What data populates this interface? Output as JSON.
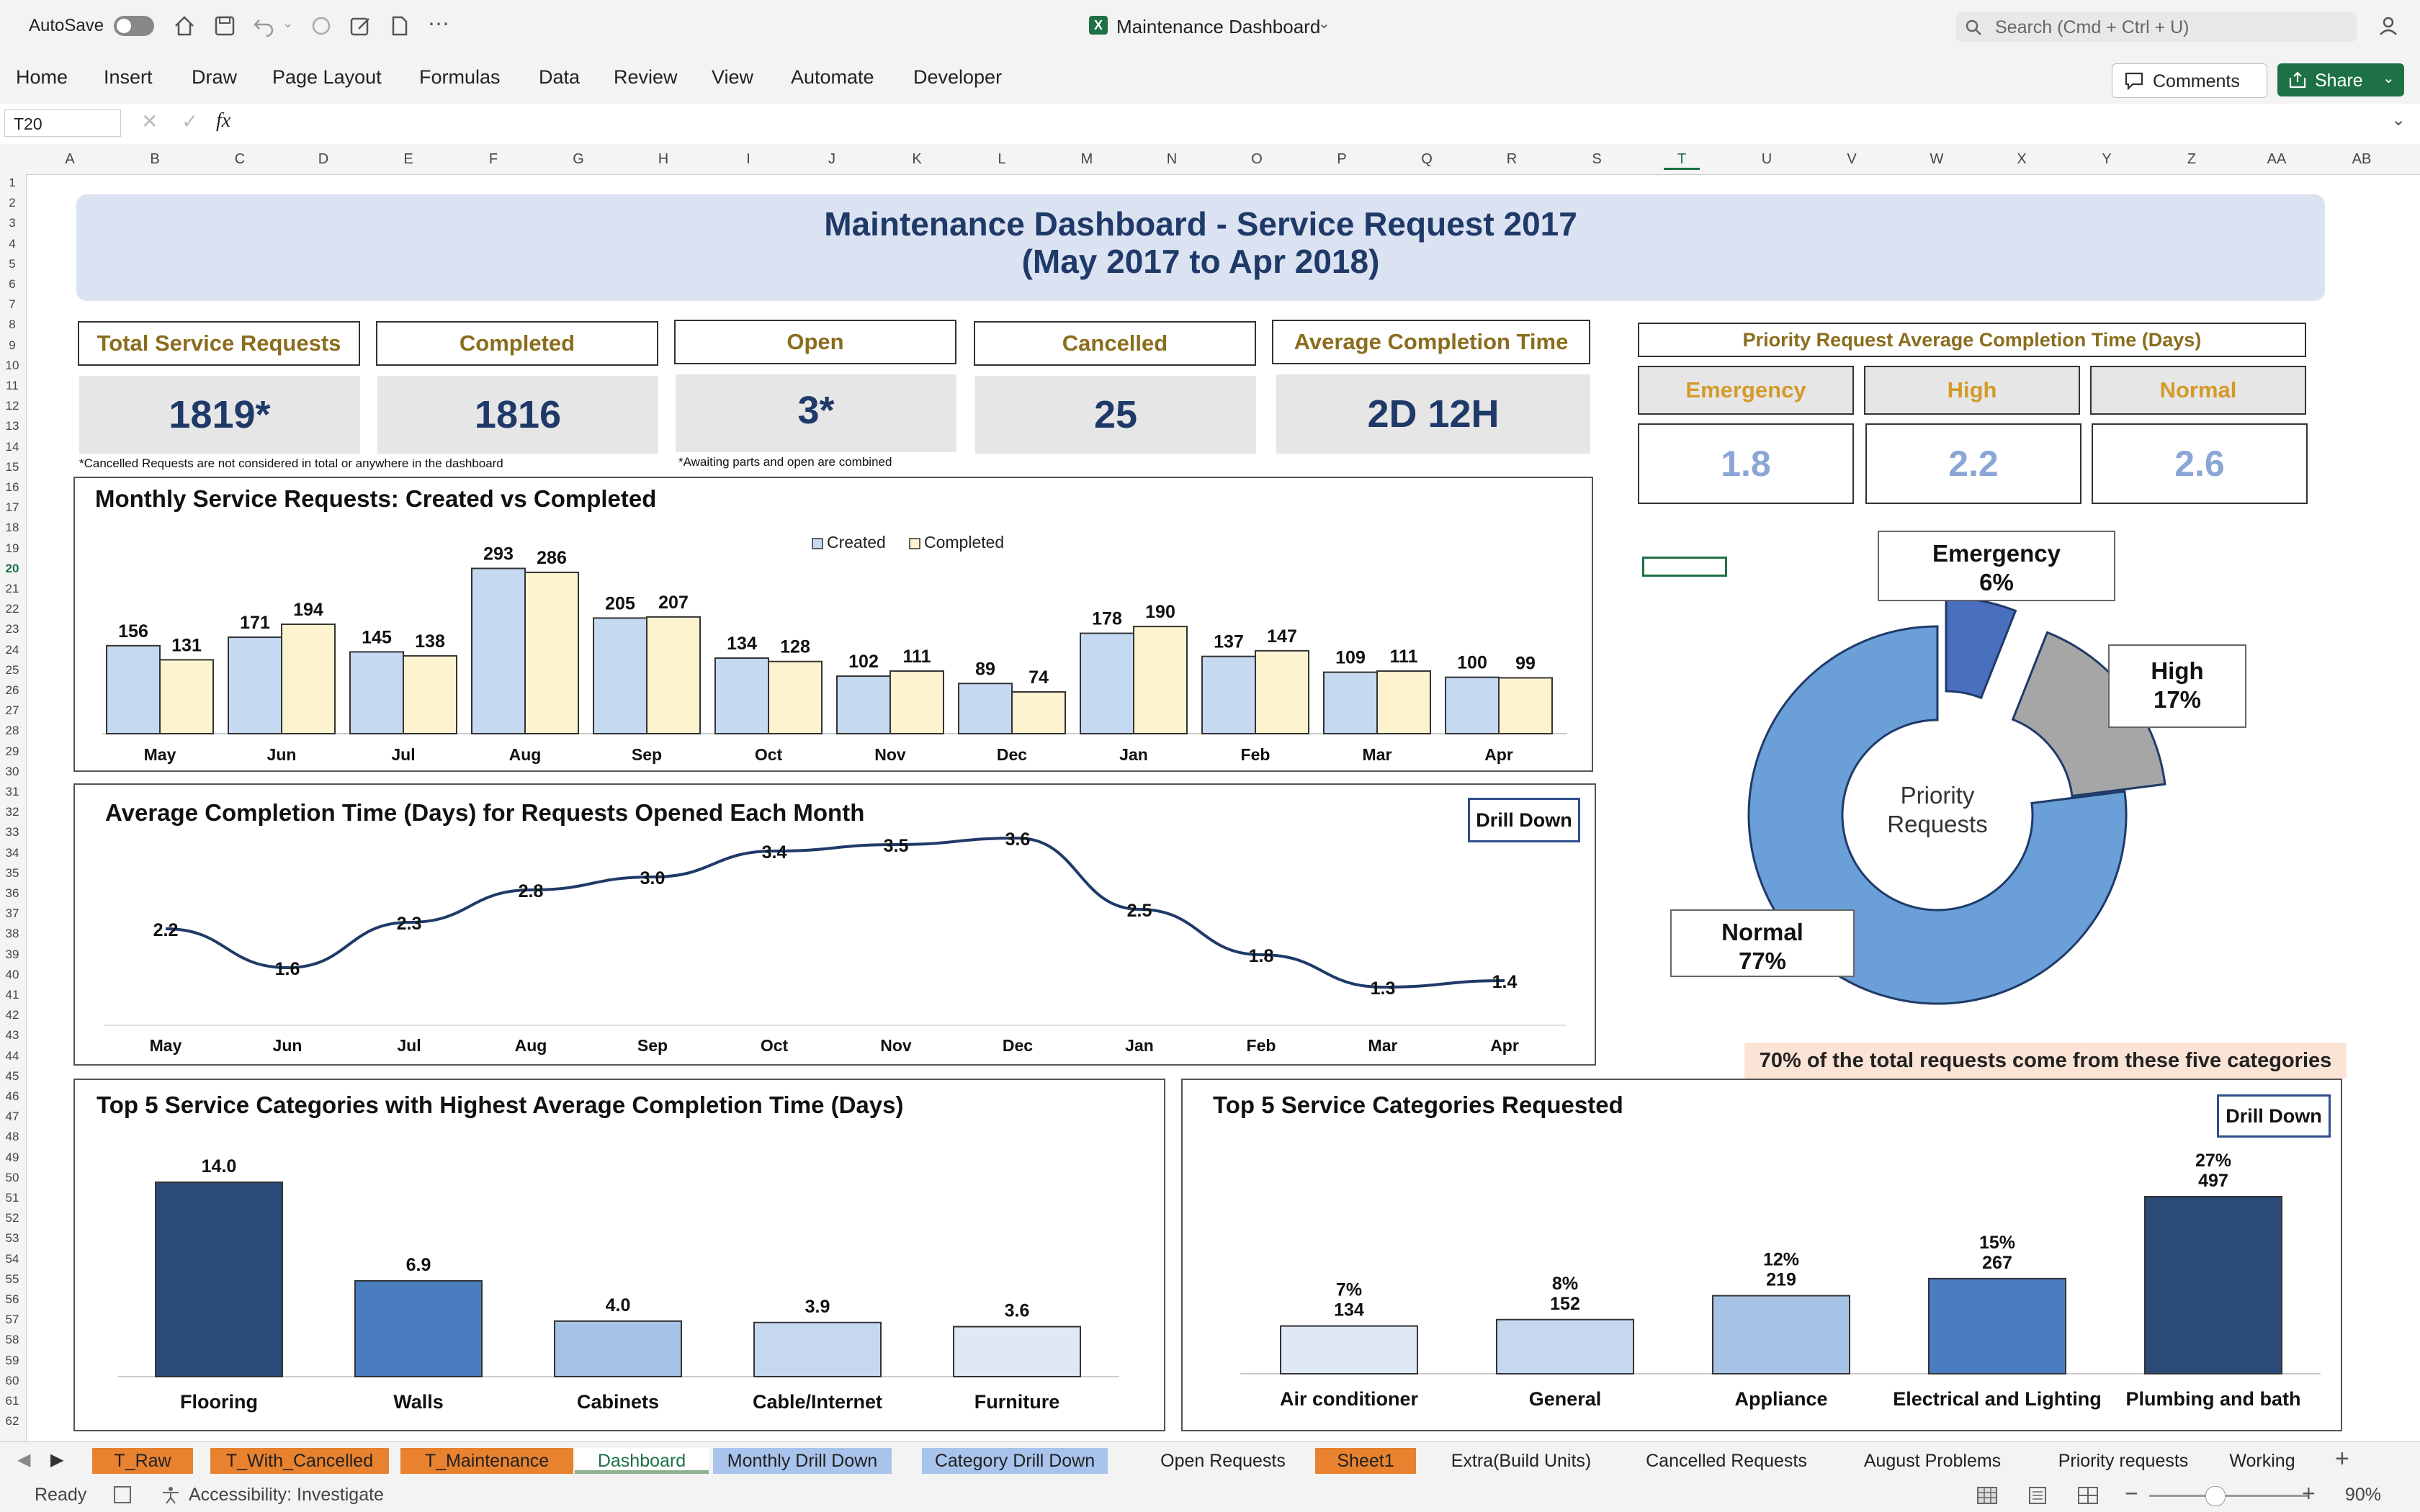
{
  "window": {
    "autosave_label": "AutoSave",
    "title": "Maintenance Dashboard",
    "search_placeholder": "Search (Cmd + Ctrl + U)",
    "comments_label": "Comments",
    "share_label": "Share"
  },
  "ribbon": {
    "tabs": [
      "Home",
      "Insert",
      "Draw",
      "Page Layout",
      "Formulas",
      "Data",
      "Review",
      "View",
      "Automate",
      "Developer"
    ]
  },
  "formula_bar": {
    "cell_ref": "T20",
    "fx": "fx",
    "value": ""
  },
  "columns": [
    "A",
    "B",
    "C",
    "D",
    "E",
    "F",
    "G",
    "H",
    "I",
    "J",
    "K",
    "L",
    "M",
    "N",
    "O",
    "P",
    "Q",
    "R",
    "S",
    "T",
    "U",
    "V",
    "W",
    "X",
    "Y",
    "Z",
    "AA",
    "AB"
  ],
  "rows": [
    "1",
    "2",
    "3",
    "4",
    "5",
    "6",
    "7",
    "8",
    "9",
    "10",
    "11",
    "12",
    "13",
    "14",
    "15",
    "16",
    "17",
    "18",
    "19",
    "20",
    "21",
    "22",
    "23",
    "24",
    "25",
    "26",
    "27",
    "28",
    "29",
    "30",
    "31",
    "32",
    "33",
    "34",
    "35",
    "36",
    "37",
    "38",
    "39",
    "40",
    "41",
    "42",
    "43",
    "44",
    "45",
    "46",
    "47",
    "48",
    "49",
    "50",
    "51",
    "52",
    "53",
    "54",
    "55",
    "56",
    "57",
    "58",
    "59",
    "60",
    "61",
    "62"
  ],
  "dashboard": {
    "title_line1": "Maintenance Dashboard - Service Request 2017",
    "title_line2": "(May 2017 to Apr 2018)",
    "kpis": [
      {
        "label": "Total Service Requests",
        "value": "1819*"
      },
      {
        "label": "Completed",
        "value": "1816"
      },
      {
        "label": "Open",
        "value": "3*"
      },
      {
        "label": "Cancelled",
        "value": "25"
      },
      {
        "label": "Average Completion Time",
        "value": "2D 12H"
      }
    ],
    "note_cancelled": "*Cancelled Requests are not considered in total or anywhere in the dashboard",
    "note_open": "*Awaiting parts and open are combined",
    "priority_title": "Priority Request Average Completion Time (Days)",
    "priority": [
      {
        "label": "Emergency",
        "value": "1.8"
      },
      {
        "label": "High",
        "value": "2.2"
      },
      {
        "label": "Normal",
        "value": "2.6"
      }
    ],
    "drill_down": "Drill Down",
    "top5_note": "70% of the total requests come from these five categories"
  },
  "chart_data": [
    {
      "type": "bar",
      "title": "Monthly Service Requests: Created vs Completed",
      "categories": [
        "May",
        "Jun",
        "Jul",
        "Aug",
        "Sep",
        "Oct",
        "Nov",
        "Dec",
        "Jan",
        "Feb",
        "Mar",
        "Apr"
      ],
      "series": [
        {
          "name": "Created",
          "values": [
            156,
            171,
            145,
            293,
            205,
            134,
            102,
            89,
            178,
            137,
            109,
            100
          ],
          "color": "#c5d9f1"
        },
        {
          "name": "Completed",
          "values": [
            131,
            194,
            138,
            286,
            207,
            128,
            111,
            74,
            190,
            147,
            111,
            99
          ],
          "color": "#fdf3cf"
        }
      ],
      "legend": "top-center"
    },
    {
      "type": "line",
      "title": "Average Completion Time (Days) for Requests Opened Each Month",
      "categories": [
        "May",
        "Jun",
        "Jul",
        "Aug",
        "Sep",
        "Oct",
        "Nov",
        "Dec",
        "Jan",
        "Feb",
        "Mar",
        "Apr"
      ],
      "series": [
        {
          "values": [
            2.2,
            1.6,
            2.3,
            2.8,
            3.0,
            3.4,
            3.5,
            3.6,
            2.5,
            1.8,
            1.3,
            1.4
          ],
          "labels": [
            "2.2",
            "1.6",
            "2.3",
            "2.8",
            "3.0",
            "3.4",
            "3.5",
            "3.6",
            "2.5",
            "1.8",
            "1.3",
            "1.4"
          ],
          "color": "#1f3a68"
        }
      ]
    },
    {
      "type": "pie",
      "title": "Priority Requests",
      "slices": [
        {
          "name": "Emergency",
          "value": 6,
          "label": "6%",
          "color": "#4a6fbf"
        },
        {
          "name": "High",
          "value": 17,
          "label": "17%",
          "color": "#a6a6a6"
        },
        {
          "name": "Normal",
          "value": 77,
          "label": "77%",
          "color": "#6a9fd8"
        }
      ]
    },
    {
      "type": "bar",
      "title": "Top 5 Service Categories with Highest Average Completion Time (Days)",
      "categories": [
        "Flooring",
        "Walls",
        "Cabinets",
        "Cable/Internet",
        "Furniture"
      ],
      "values": [
        14.0,
        6.9,
        4.0,
        3.9,
        3.6
      ],
      "labels": [
        "14.0",
        "6.9",
        "4.0",
        "3.9",
        "3.6"
      ],
      "colors": [
        "#2b4a78",
        "#4a7cc0",
        "#a6c3e6",
        "#c5d8f0",
        "#dfe8f5"
      ]
    },
    {
      "type": "bar",
      "title": "Top 5 Service Categories Requested",
      "categories": [
        "Air conditioner",
        "General",
        "Appliance",
        "Electrical and Lighting",
        "Plumbing and bath"
      ],
      "values": [
        134,
        152,
        219,
        267,
        497
      ],
      "percent_labels": [
        "7%",
        "8%",
        "12%",
        "15%",
        "27%"
      ],
      "labels": [
        "134",
        "152",
        "219",
        "267",
        "497"
      ],
      "colors": [
        "#dfe8f5",
        "#c5d8f0",
        "#a6c3e6",
        "#4a7cc0",
        "#2b4a78"
      ]
    }
  ],
  "sheet_tabs": [
    {
      "name": "T_Raw",
      "color": "#e8822e"
    },
    {
      "name": "T_With_Cancelled",
      "color": "#e8822e"
    },
    {
      "name": "T_Maintenance",
      "color": "#e8822e"
    },
    {
      "name": "Dashboard",
      "color": "#8fb08f",
      "active": true
    },
    {
      "name": "Monthly Drill Down",
      "color": "#a9c4ec"
    },
    {
      "name": "Category Drill Down",
      "color": "#a9c4ec"
    },
    {
      "name": "Open Requests",
      "color": ""
    },
    {
      "name": "Sheet1",
      "color": "#e8822e"
    },
    {
      "name": "Extra(Build Units)",
      "color": ""
    },
    {
      "name": "Cancelled Requests",
      "color": ""
    },
    {
      "name": "August Problems",
      "color": ""
    },
    {
      "name": "Priority requests",
      "color": ""
    },
    {
      "name": "Working",
      "color": ""
    }
  ],
  "status": {
    "ready": "Ready",
    "accessibility": "Accessibility: Investigate",
    "zoom": "90%"
  }
}
